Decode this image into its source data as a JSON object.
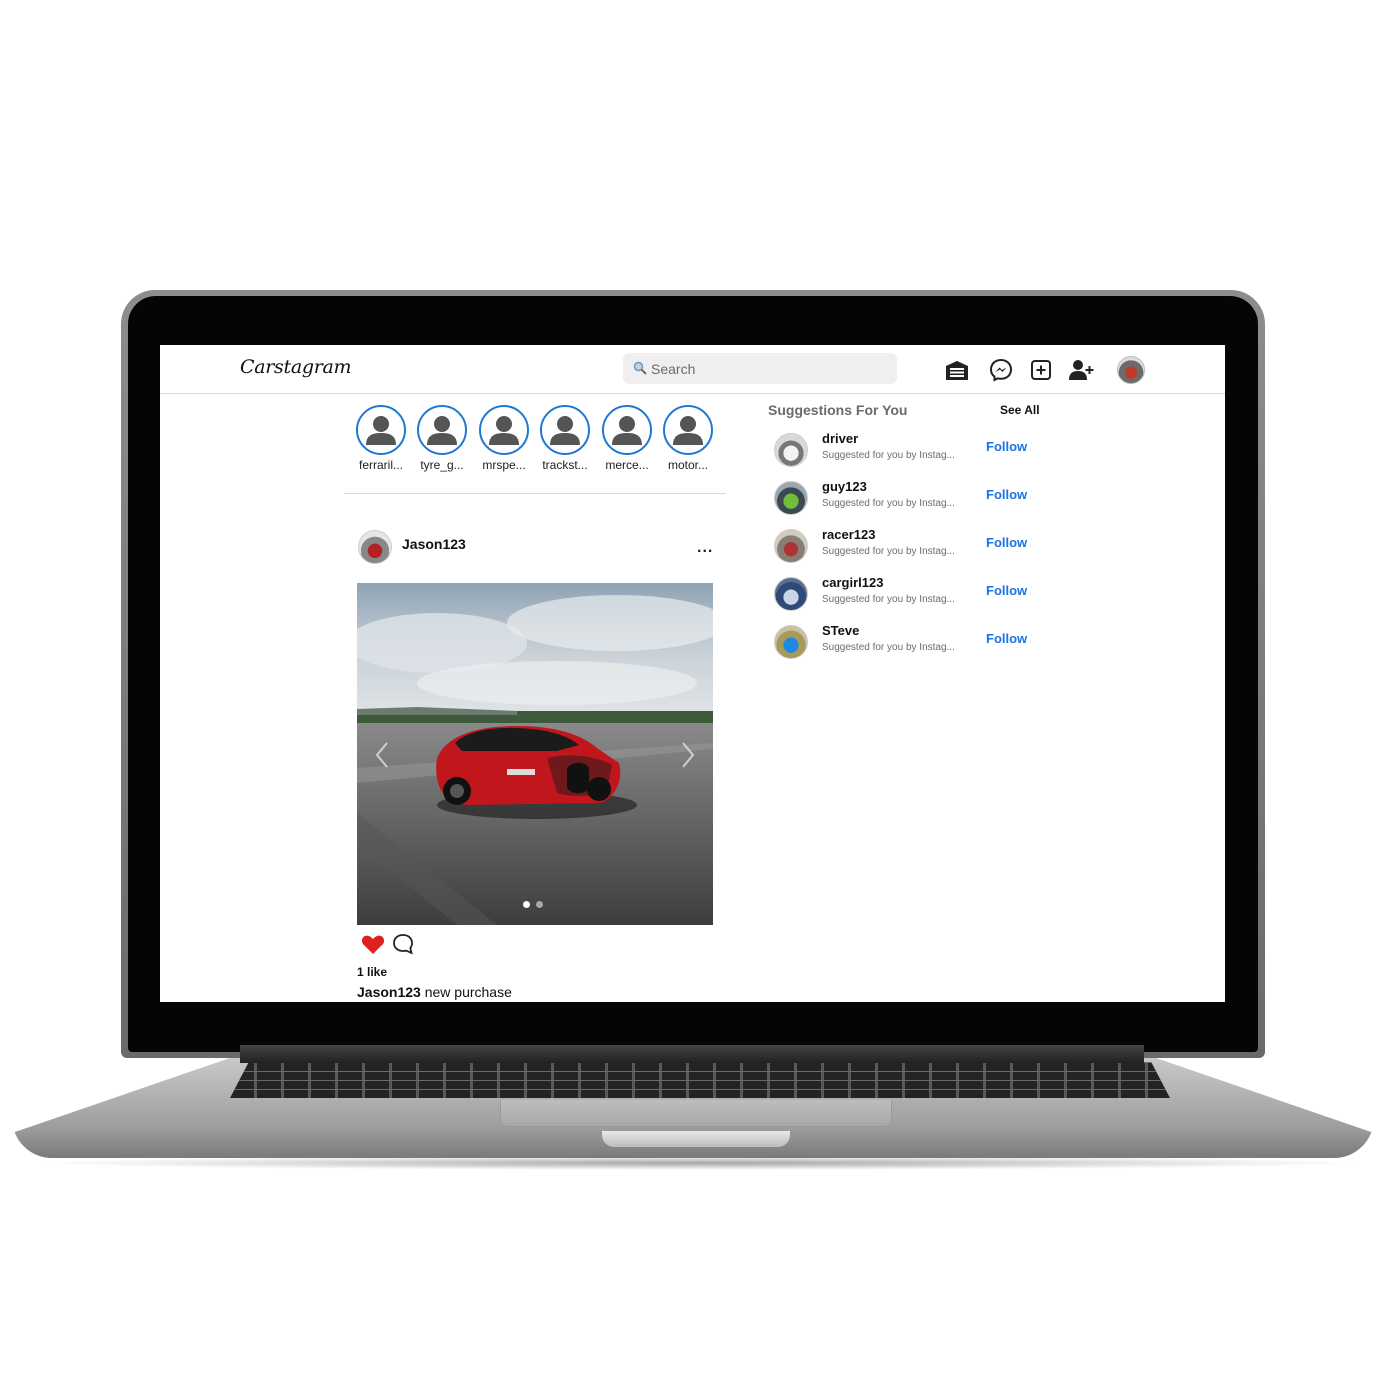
{
  "app": {
    "logo": "Carstagram"
  },
  "search": {
    "placeholder": "Search",
    "icon": "search-icon"
  },
  "nav": {
    "icons": [
      "garage-icon",
      "messenger-icon",
      "new-post-icon",
      "add-user-icon",
      "profile-avatar"
    ]
  },
  "stories": [
    {
      "name": "ferraril..."
    },
    {
      "name": "tyre_g..."
    },
    {
      "name": "mrspe..."
    },
    {
      "name": "trackst..."
    },
    {
      "name": "merce..."
    },
    {
      "name": "motor..."
    }
  ],
  "post": {
    "username": "Jason123",
    "more": "...",
    "likes": "1 like",
    "caption_user": "Jason123",
    "caption_text": " new purchase",
    "carousel": {
      "total": 2,
      "current": 1
    }
  },
  "suggestions": {
    "title": "Suggestions For You",
    "see_all": "See All",
    "items": [
      {
        "name": "driver",
        "subtitle": "Suggested for you by Instag...",
        "action": "Follow"
      },
      {
        "name": "guy123",
        "subtitle": "Suggested for you by Instag...",
        "action": "Follow"
      },
      {
        "name": "racer123",
        "subtitle": "Suggested for you by Instag...",
        "action": "Follow"
      },
      {
        "name": "cargirl123",
        "subtitle": "Suggested for you by Instag...",
        "action": "Follow"
      },
      {
        "name": "STeve",
        "subtitle": "Suggested for you by Instag...",
        "action": "Follow"
      }
    ]
  },
  "colors": {
    "accent": "#1a73e8",
    "story_ring": "#1f78d1",
    "like": "#e0201f"
  }
}
